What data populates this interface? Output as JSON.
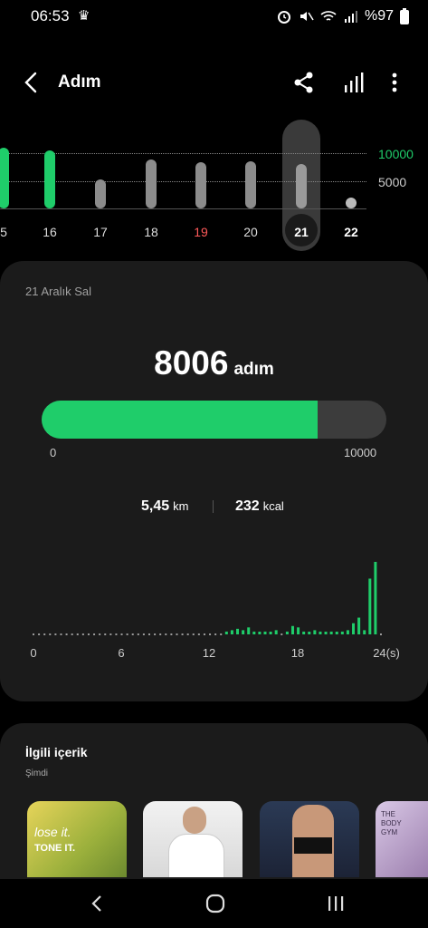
{
  "status_bar": {
    "time": "06:53",
    "battery": "%97",
    "icons": [
      "alarm-icon",
      "mute-icon",
      "wifi-icon",
      "signal-icon",
      "accessibility-icon"
    ]
  },
  "app_bar": {
    "title": "Adım",
    "actions": [
      "share-icon",
      "stats-icon",
      "more-icon"
    ]
  },
  "week_chart": {
    "goal_label": "10000",
    "half_label": "5000",
    "days": [
      {
        "label": "5",
        "steps": 11000,
        "goal_met": true
      },
      {
        "label": "16",
        "steps": 10500,
        "goal_met": true
      },
      {
        "label": "17",
        "steps": 5300
      },
      {
        "label": "18",
        "steps": 8800
      },
      {
        "label": "19",
        "steps": 8400,
        "weekend": true
      },
      {
        "label": "20",
        "steps": 8500
      },
      {
        "label": "21",
        "steps": 8006,
        "selected": true
      },
      {
        "label": "22",
        "steps": 0,
        "today": true
      }
    ],
    "colors": {
      "goal": "#1fcd6a",
      "normal": "#8c8c8c",
      "weekend_label": "#ff5a5a"
    }
  },
  "summary": {
    "date": "21 Aralık Sal",
    "steps": "8006",
    "steps_unit": "adım",
    "progress_fraction": 0.8006,
    "progress_min": "0",
    "progress_max": "10000",
    "distance": "5,45",
    "distance_unit": "km",
    "calories": "232",
    "calories_unit": "kcal"
  },
  "hourly": {
    "axis_labels": [
      "0",
      "6",
      "12",
      "18",
      "24(s)"
    ],
    "values": [
      0,
      0,
      0,
      0,
      0,
      0,
      0,
      0,
      0,
      0,
      0,
      0,
      0,
      0,
      0,
      0,
      0,
      0,
      0,
      0,
      0,
      0,
      0,
      0,
      0,
      0,
      0,
      0,
      0,
      0,
      0,
      0,
      0,
      0,
      0,
      2,
      3,
      4,
      3,
      5,
      2,
      1,
      2,
      1,
      3,
      0,
      2,
      6,
      5,
      2,
      1,
      3,
      2,
      1,
      2,
      1,
      2,
      3,
      8,
      12,
      3,
      40,
      52,
      0
    ]
  },
  "related": {
    "title": "İlgili içerik",
    "subtitle": "Şimdi",
    "thumb_texts": [
      "lose it.",
      "TONE IT.",
      "THE BODY GYM"
    ]
  },
  "nav": [
    "recents-back-icon",
    "home-icon",
    "recent-apps-icon"
  ]
}
